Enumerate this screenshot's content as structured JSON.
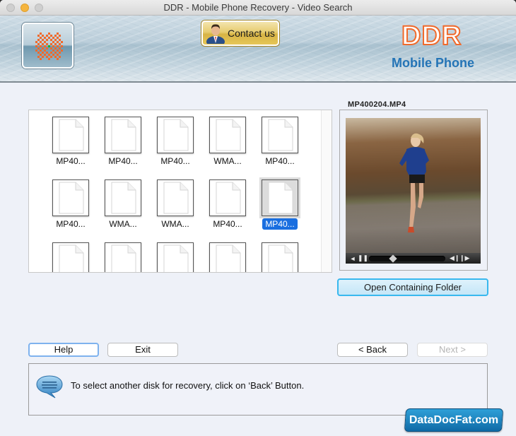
{
  "window": {
    "title": "DDR - Mobile Phone Recovery - Video Search"
  },
  "header": {
    "contact_label": "Contact us",
    "brand_title": "DDR",
    "brand_subtitle": "Mobile Phone",
    "brand_color": "#f06a2c",
    "subtitle_color": "#2474b6"
  },
  "files": {
    "items": [
      {
        "name": "MP40...",
        "selected": false
      },
      {
        "name": "MP40...",
        "selected": false
      },
      {
        "name": "MP40...",
        "selected": false
      },
      {
        "name": "WMA...",
        "selected": false
      },
      {
        "name": "MP40...",
        "selected": false
      },
      {
        "name": "MP40...",
        "selected": false
      },
      {
        "name": "WMA...",
        "selected": false
      },
      {
        "name": "WMA...",
        "selected": false
      },
      {
        "name": "MP40...",
        "selected": false
      },
      {
        "name": "MP40...",
        "selected": true
      },
      {
        "name": "",
        "selected": false
      },
      {
        "name": "",
        "selected": false
      },
      {
        "name": "",
        "selected": false
      },
      {
        "name": "",
        "selected": false
      },
      {
        "name": "",
        "selected": false
      }
    ],
    "selection_color": "#1a6fe0"
  },
  "preview": {
    "label": "MP400204.MP4",
    "playback_position": 0.3,
    "open_folder_label": "Open Containing Folder"
  },
  "buttons": {
    "help": "Help",
    "exit": "Exit",
    "back": "< Back",
    "next": "Next >"
  },
  "status": {
    "message": "To select another disk for recovery, click on ‘Back’ Button."
  },
  "watermark": {
    "text": "DataDocFat.com"
  }
}
